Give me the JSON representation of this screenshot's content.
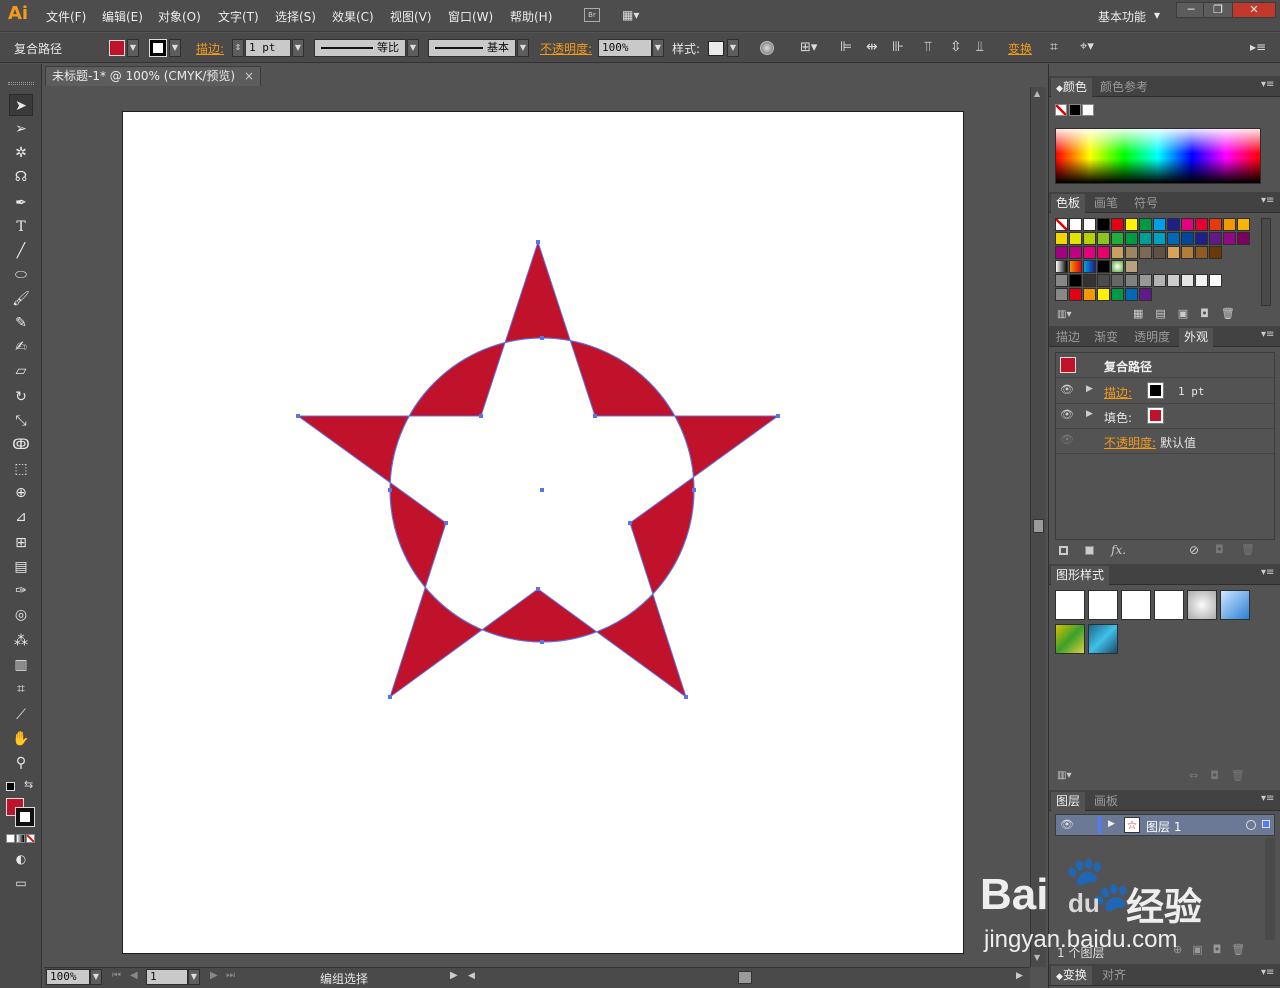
{
  "app": {
    "logo": "Ai",
    "workspace": "基本功能",
    "workspace_dd": "▾",
    "window_buttons": [
      "─",
      "❐",
      "✕"
    ],
    "bridge": "Br"
  },
  "menu": [
    "文件(F)",
    "编辑(E)",
    "对象(O)",
    "文字(T)",
    "选择(S)",
    "效果(C)",
    "视图(V)",
    "窗口(W)",
    "帮助(H)"
  ],
  "control": {
    "selection": "复合路径",
    "stroke_label": "描边:",
    "stroke_weight": "1 pt",
    "profile_label": "等比",
    "brush_label": "基本",
    "opacity_label": "不透明度:",
    "opacity_value": "100%",
    "style_label": "样式:",
    "transform_label": "变换"
  },
  "document": {
    "tab_title": "未标题-1* @ 100% (CMYK/预览)",
    "close": "×"
  },
  "status": {
    "zoom": "100%",
    "page": "1",
    "message": "编组选择"
  },
  "colors": {
    "fill": "#c0122a",
    "stroke": "#000000",
    "path": "#5a73e6",
    "accent": "#f39a1c"
  },
  "panels": {
    "color": {
      "tabs": [
        "颜色",
        "颜色参考"
      ]
    },
    "swatches": {
      "tabs": [
        "色板",
        "画笔",
        "符号"
      ]
    },
    "appearance": {
      "tabs": [
        "描边",
        "渐变",
        "透明度",
        "外观"
      ],
      "title": "复合路径",
      "rows": [
        {
          "label": "描边:",
          "value": "1 pt"
        },
        {
          "label": "填色:",
          "value": ""
        },
        {
          "label": "不透明度:",
          "value": "默认值"
        }
      ],
      "fx": "fx."
    },
    "graphic_styles": {
      "tabs": [
        "图形样式"
      ]
    },
    "layers": {
      "tabs": [
        "图层",
        "画板"
      ],
      "layer_name": "图层 1",
      "footer": "1 个图层"
    },
    "bottom": {
      "tabs": [
        "变换",
        "对齐"
      ]
    }
  },
  "watermark": {
    "brand": "Bai",
    "brand2": "du",
    "sub": "经验",
    "url": "jingyan.baidu.com"
  }
}
